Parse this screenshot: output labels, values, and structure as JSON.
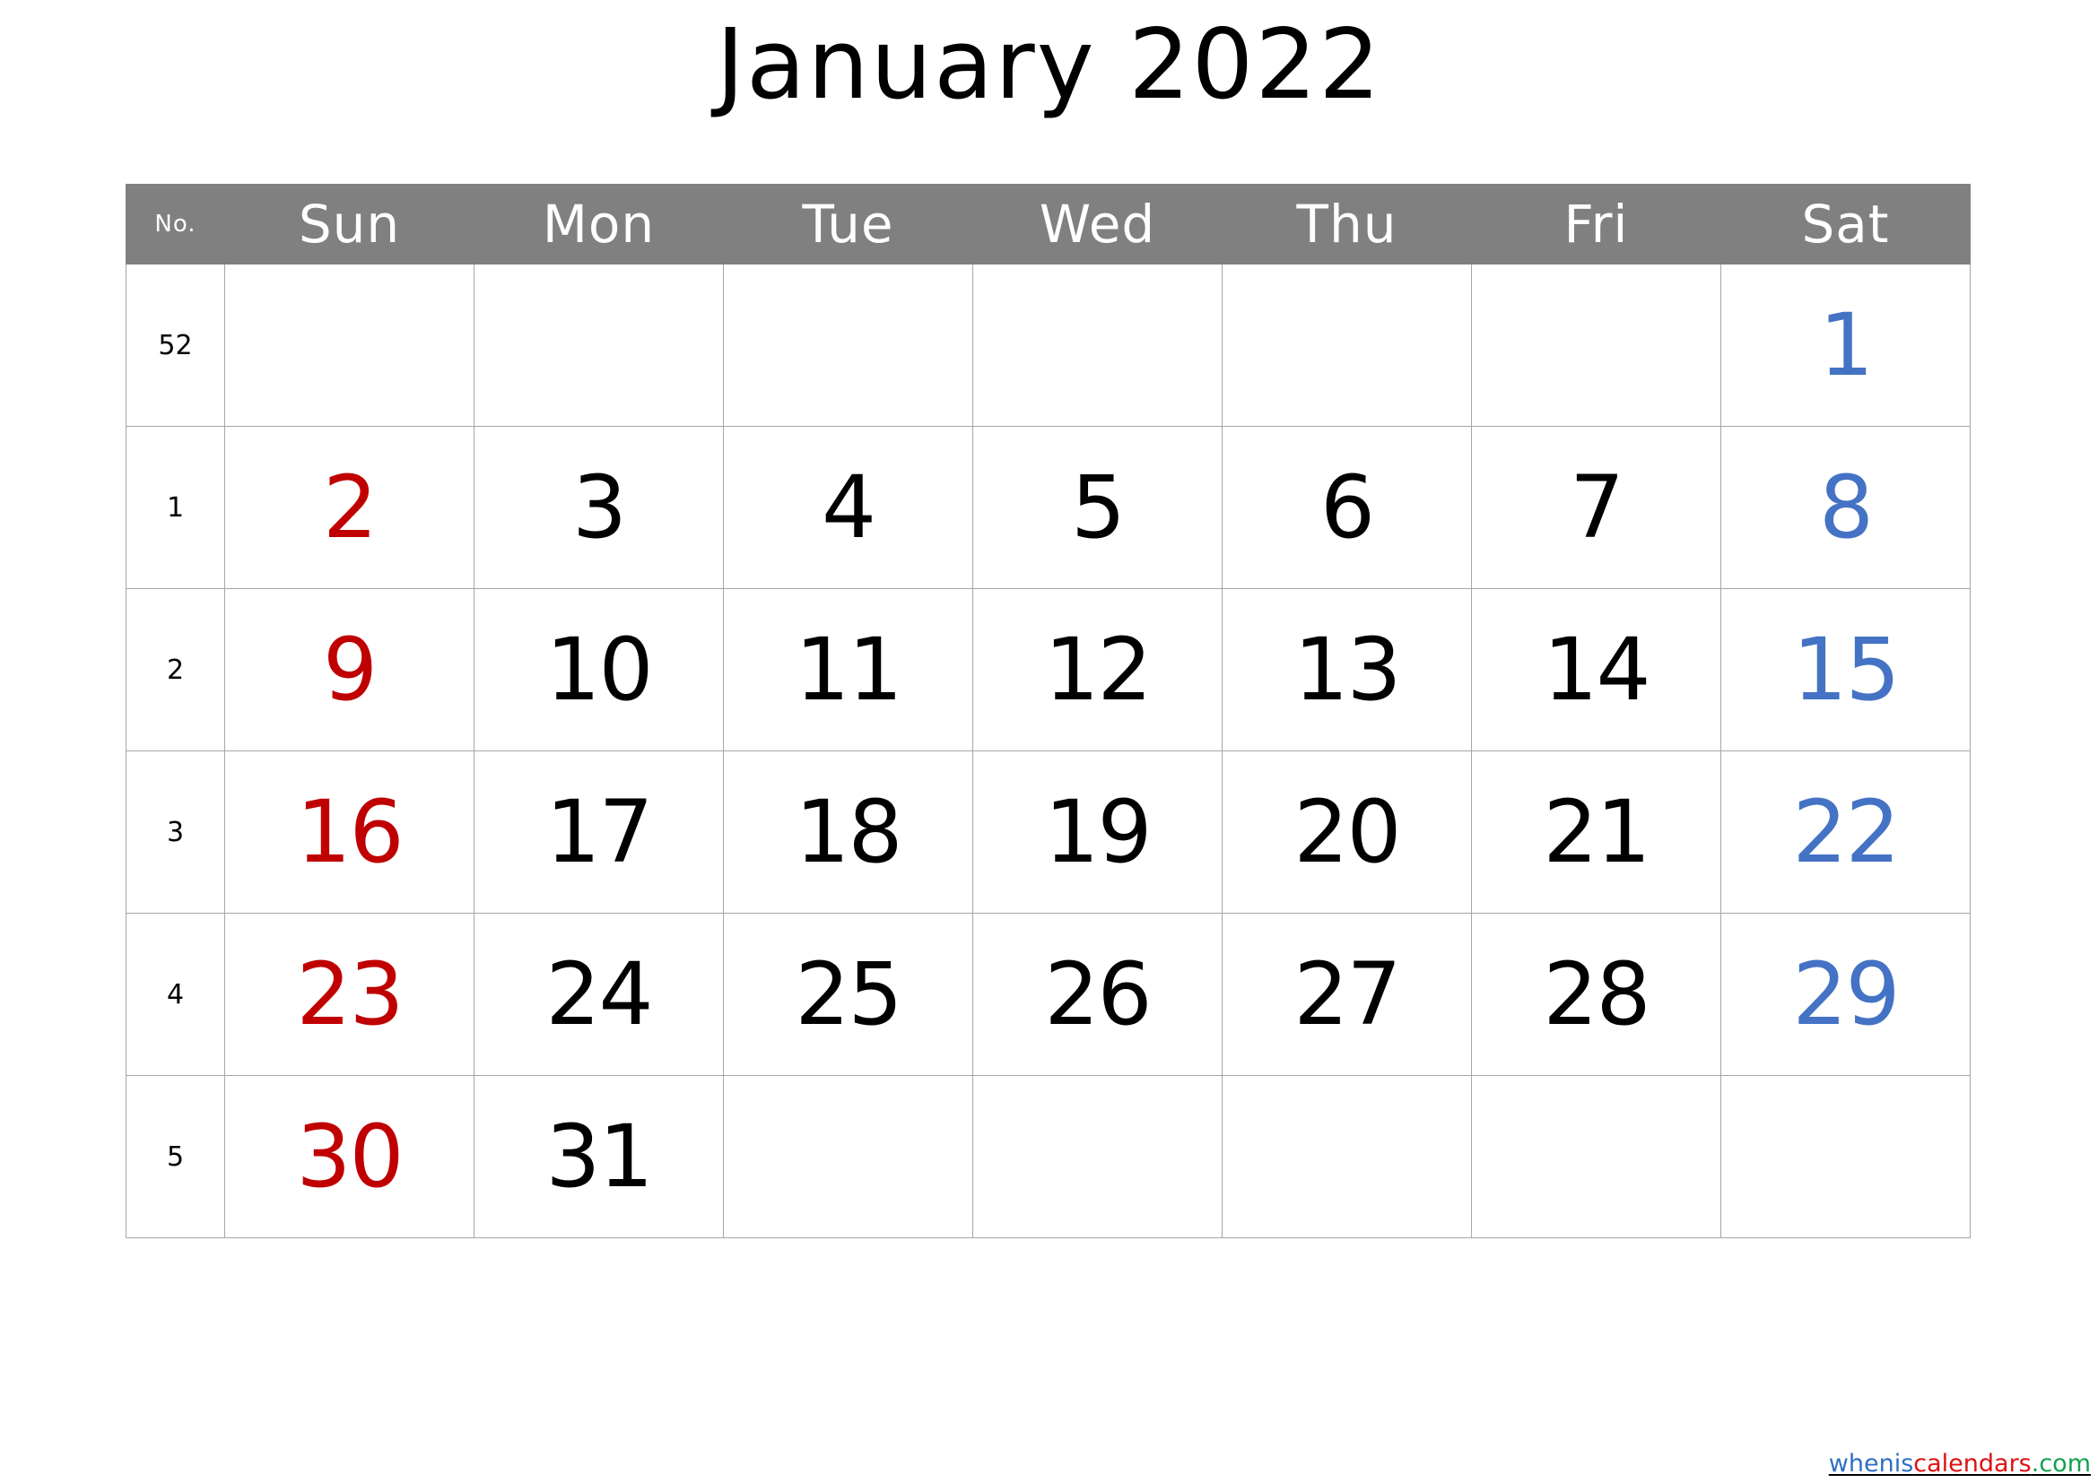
{
  "document": {
    "title": "January 2022",
    "month": "January",
    "year": "2022"
  },
  "colors": {
    "header_bg": "#808080",
    "header_text": "#ffffff",
    "grid_line": "#a6a6a6",
    "weekday_text": "#000000",
    "sunday_text": "#c00000",
    "saturday_text": "#4472c4",
    "watermark_blue": "#2f6fc4",
    "watermark_red": "#dd1111",
    "watermark_green": "#12a150"
  },
  "table": {
    "headers": {
      "week_no": "No.",
      "days": [
        "Sun",
        "Mon",
        "Tue",
        "Wed",
        "Thu",
        "Fri",
        "Sat"
      ]
    },
    "rows": [
      {
        "week_no": "52",
        "days": [
          {
            "num": "",
            "color": "black"
          },
          {
            "num": "",
            "color": "black"
          },
          {
            "num": "",
            "color": "black"
          },
          {
            "num": "",
            "color": "black"
          },
          {
            "num": "",
            "color": "black"
          },
          {
            "num": "",
            "color": "black"
          },
          {
            "num": "1",
            "color": "blue"
          }
        ]
      },
      {
        "week_no": "1",
        "days": [
          {
            "num": "2",
            "color": "red"
          },
          {
            "num": "3",
            "color": "black"
          },
          {
            "num": "4",
            "color": "black"
          },
          {
            "num": "5",
            "color": "black"
          },
          {
            "num": "6",
            "color": "black"
          },
          {
            "num": "7",
            "color": "black"
          },
          {
            "num": "8",
            "color": "blue"
          }
        ]
      },
      {
        "week_no": "2",
        "days": [
          {
            "num": "9",
            "color": "red"
          },
          {
            "num": "10",
            "color": "black"
          },
          {
            "num": "11",
            "color": "black"
          },
          {
            "num": "12",
            "color": "black"
          },
          {
            "num": "13",
            "color": "black"
          },
          {
            "num": "14",
            "color": "black"
          },
          {
            "num": "15",
            "color": "blue"
          }
        ]
      },
      {
        "week_no": "3",
        "days": [
          {
            "num": "16",
            "color": "red"
          },
          {
            "num": "17",
            "color": "black"
          },
          {
            "num": "18",
            "color": "black"
          },
          {
            "num": "19",
            "color": "black"
          },
          {
            "num": "20",
            "color": "black"
          },
          {
            "num": "21",
            "color": "black"
          },
          {
            "num": "22",
            "color": "blue"
          }
        ]
      },
      {
        "week_no": "4",
        "days": [
          {
            "num": "23",
            "color": "red"
          },
          {
            "num": "24",
            "color": "black"
          },
          {
            "num": "25",
            "color": "black"
          },
          {
            "num": "26",
            "color": "black"
          },
          {
            "num": "27",
            "color": "black"
          },
          {
            "num": "28",
            "color": "black"
          },
          {
            "num": "29",
            "color": "blue"
          }
        ]
      },
      {
        "week_no": "5",
        "days": [
          {
            "num": "30",
            "color": "red"
          },
          {
            "num": "31",
            "color": "black"
          },
          {
            "num": "",
            "color": "black"
          },
          {
            "num": "",
            "color": "black"
          },
          {
            "num": "",
            "color": "black"
          },
          {
            "num": "",
            "color": "black"
          },
          {
            "num": "",
            "color": "black"
          }
        ]
      }
    ]
  },
  "watermark": {
    "part1": "whenis",
    "part2": "calendars",
    "part3": ".com"
  }
}
